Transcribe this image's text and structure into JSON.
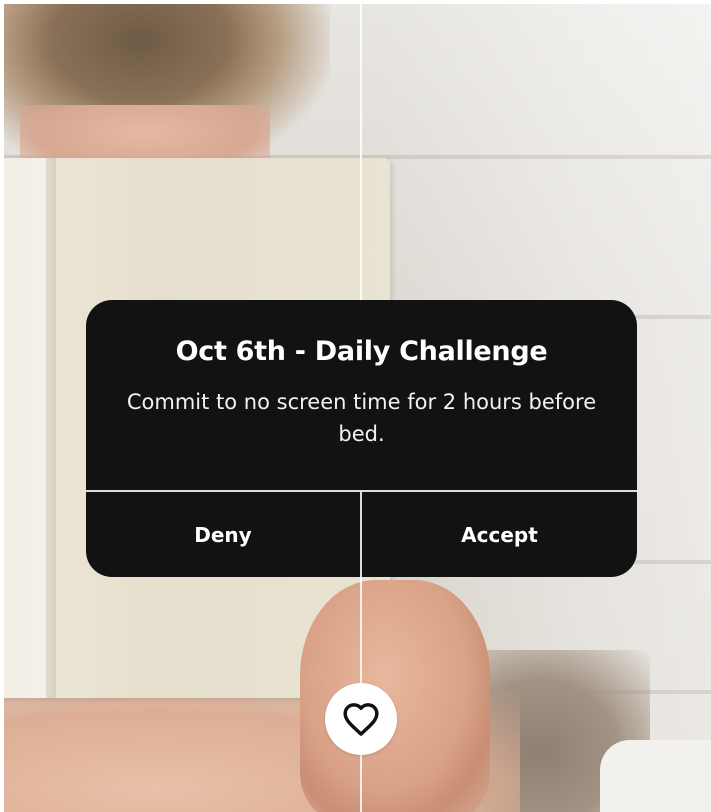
{
  "dialog": {
    "title": "Oct 6th - Daily Challenge",
    "message": "Commit to no screen time for 2 hours before bed.",
    "deny_label": "Deny",
    "accept_label": "Accept"
  },
  "actions": {
    "like_icon": "heart-icon"
  },
  "colors": {
    "dialog_background": "#121212",
    "dialog_text": "#ffffff",
    "divider": "#dcdcdc",
    "heart_button_background": "#ffffff"
  }
}
